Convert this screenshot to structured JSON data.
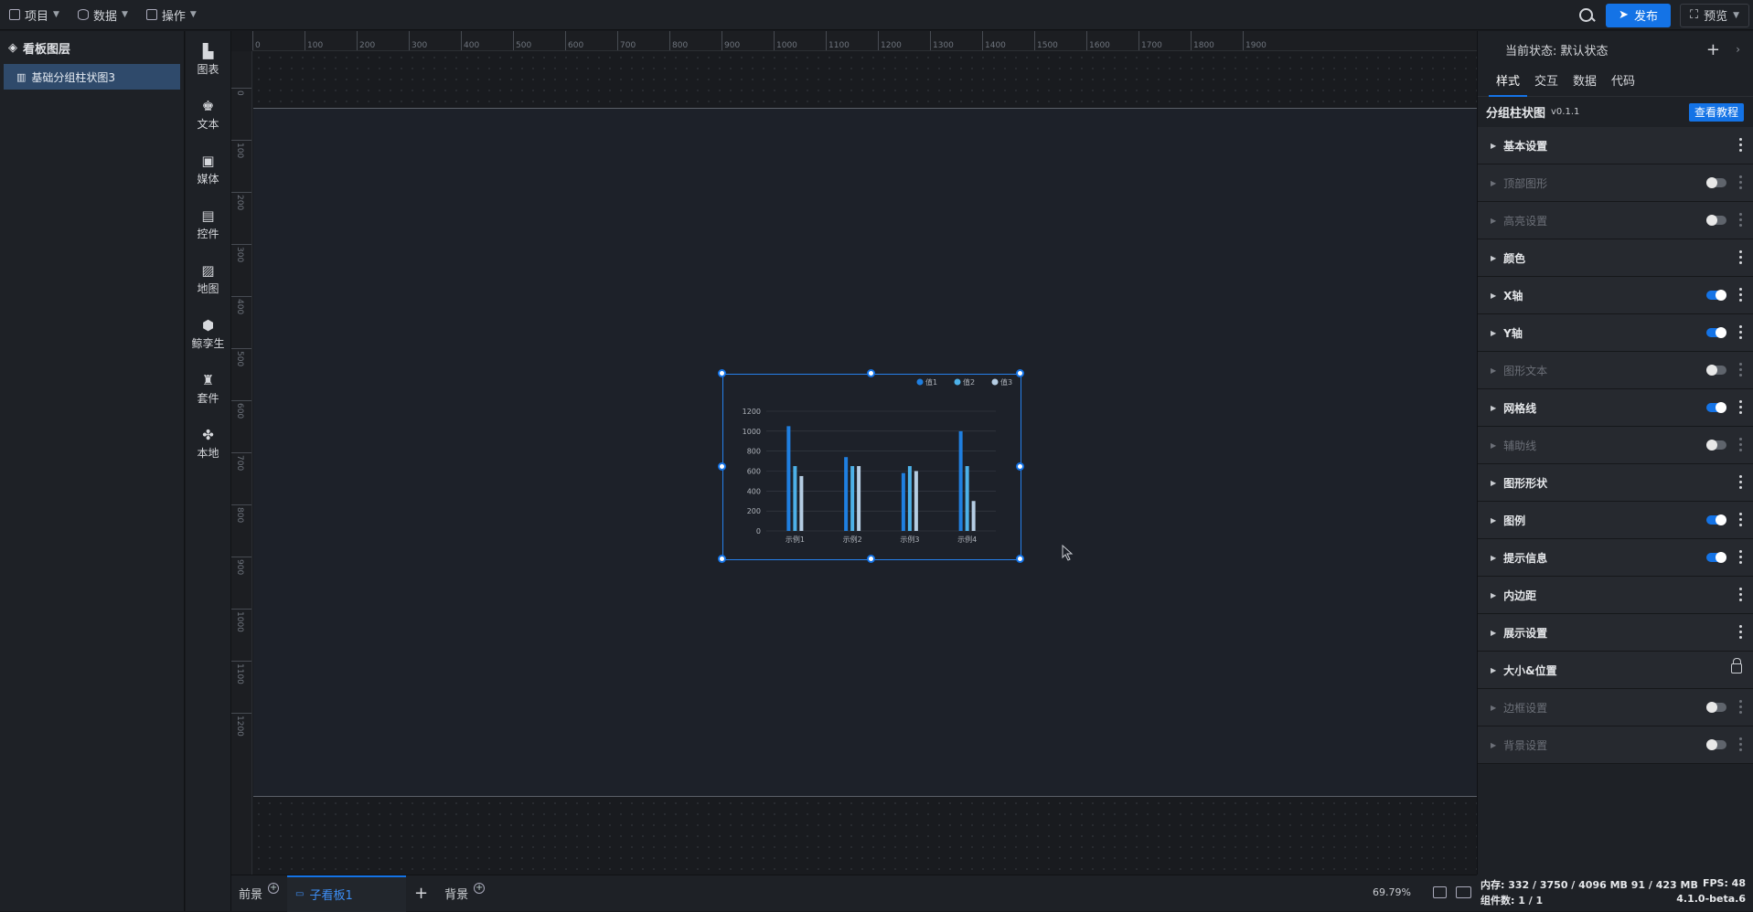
{
  "topbar": {
    "menus": [
      {
        "label": "项目",
        "icon": "file-icon"
      },
      {
        "label": "数据",
        "icon": "database-icon"
      },
      {
        "label": "操作",
        "icon": "grid-icon"
      }
    ],
    "publish_label": "发布",
    "preview_label": "预览"
  },
  "layers": {
    "title": "看板图层",
    "items": [
      {
        "label": "基础分组柱状图3"
      }
    ]
  },
  "toolbox": {
    "items": [
      {
        "label": "图表",
        "icon": "bar-chart-icon"
      },
      {
        "label": "文本",
        "icon": "text-icon"
      },
      {
        "label": "媒体",
        "icon": "media-icon"
      },
      {
        "label": "控件",
        "icon": "widget-icon"
      },
      {
        "label": "地图",
        "icon": "map-icon"
      },
      {
        "label": "鲸孪生",
        "icon": "cube-icon"
      },
      {
        "label": "套件",
        "icon": "shirt-icon"
      },
      {
        "label": "本地",
        "icon": "puzzle-icon"
      }
    ]
  },
  "ruler": {
    "h_ticks": [
      "0",
      "100",
      "200",
      "300",
      "400",
      "500",
      "600",
      "700",
      "800",
      "900",
      "1000",
      "1100",
      "1200",
      "1300",
      "1400",
      "1500",
      "1600",
      "1700",
      "1800",
      "1900"
    ],
    "v_ticks": [
      "0",
      "100",
      "200",
      "300",
      "400",
      "500",
      "600",
      "700",
      "800",
      "900",
      "1000",
      "1100",
      "1200"
    ]
  },
  "chart_data": {
    "type": "bar",
    "categories": [
      "示例1",
      "示例2",
      "示例3",
      "示例4"
    ],
    "series": [
      {
        "name": "值1",
        "values": [
          1050,
          740,
          580,
          1000
        ],
        "color": "#1f7fe0"
      },
      {
        "name": "值2",
        "values": [
          650,
          650,
          650,
          650
        ],
        "color": "#4db1e8"
      },
      {
        "name": "值3",
        "values": [
          550,
          650,
          600,
          300
        ],
        "color": "#b5cde3"
      }
    ],
    "y_ticks": [
      0,
      200,
      400,
      600,
      800,
      1000,
      1200
    ],
    "ylim": [
      0,
      1200
    ],
    "legend_position": "top-right",
    "grid": true
  },
  "bottombar": {
    "tabs": [
      {
        "label": "前景"
      },
      {
        "label": "子看板1"
      },
      {
        "label": "背景"
      }
    ],
    "add_label": "+",
    "zoom": "69.79%"
  },
  "props": {
    "state_label": "当前状态:  默认状态",
    "tabs": [
      "样式",
      "交互",
      "数据",
      "代码"
    ],
    "component_name": "分组柱状图",
    "component_version": "v0.1.1",
    "tutorial_label": "查看教程",
    "sections": [
      {
        "label": "基本设置",
        "control": "more",
        "dim": false
      },
      {
        "label": "顶部图形",
        "control": "toggle-off",
        "dim": true
      },
      {
        "label": "高亮设置",
        "control": "toggle-off",
        "dim": true
      },
      {
        "label": "颜色",
        "control": "more",
        "dim": false
      },
      {
        "label": "X轴",
        "control": "toggle-on",
        "dim": false
      },
      {
        "label": "Y轴",
        "control": "toggle-on",
        "dim": false
      },
      {
        "label": "图形文本",
        "control": "toggle-off",
        "dim": true
      },
      {
        "label": "网格线",
        "control": "toggle-on",
        "dim": false
      },
      {
        "label": "辅助线",
        "control": "toggle-off",
        "dim": true
      },
      {
        "label": "图形形状",
        "control": "more",
        "dim": false
      },
      {
        "label": "图例",
        "control": "toggle-on",
        "dim": false
      },
      {
        "label": "提示信息",
        "control": "toggle-on",
        "dim": false
      },
      {
        "label": "内边距",
        "control": "more",
        "dim": false
      },
      {
        "label": "展示设置",
        "control": "more",
        "dim": false
      },
      {
        "label": "大小&位置",
        "control": "lock",
        "dim": false
      },
      {
        "label": "边框设置",
        "control": "toggle-off",
        "dim": true
      },
      {
        "label": "背景设置",
        "control": "toggle-off",
        "dim": true
      }
    ]
  },
  "status": {
    "memory": "内存:  332 / 3750 / 4096 MB  91 / 423 MB",
    "fps": "FPS:  48",
    "components": "组件数: 1 / 1",
    "version": "4.1.0-beta.6"
  }
}
